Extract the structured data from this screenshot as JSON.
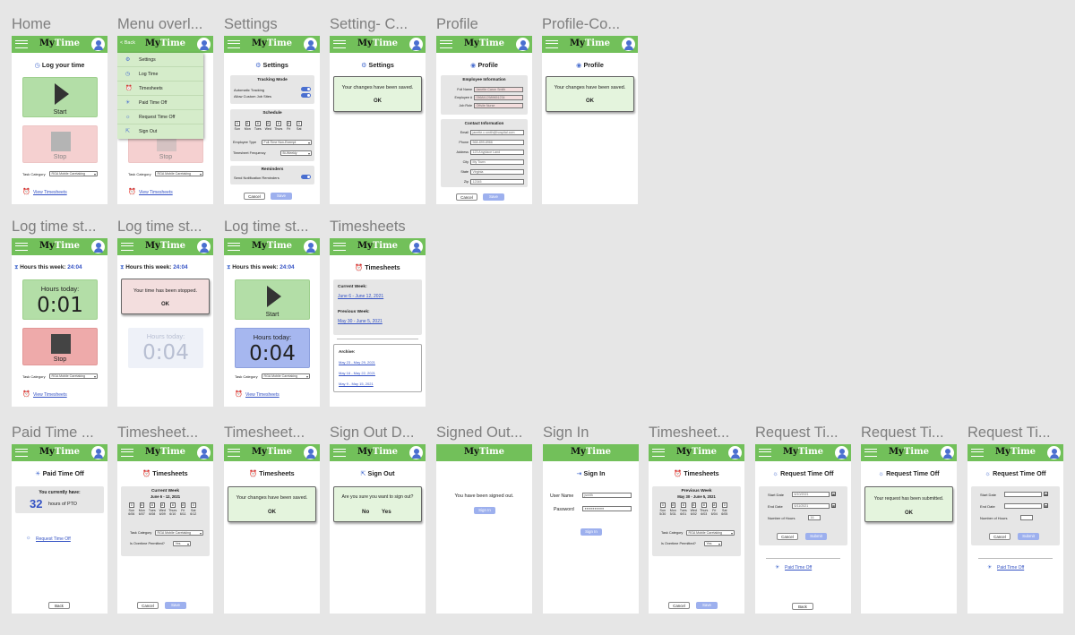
{
  "app": {
    "logo_my": "My",
    "logo_time": "Time",
    "back": "< Back"
  },
  "frames": {
    "home": "Home",
    "menu": "Menu overl...",
    "settings": "Settings",
    "settings_c": "Setting- C...",
    "profile": "Profile",
    "profile_c": "Profile-Co...",
    "lts1": "Log time st...",
    "lts2": "Log time st...",
    "lts3": "Log time st...",
    "timesheets": "Timesheets",
    "pto": "Paid Time ...",
    "ts1": "Timesheet...",
    "ts2": "Timesheet...",
    "signout": "Sign Out D...",
    "signedout": "Signed Out...",
    "signin": "Sign In",
    "ts3": "Timesheet...",
    "rto1": "Request Ti...",
    "rto2": "Request Ti...",
    "rto3": "Request Ti..."
  },
  "home": {
    "title": "Log your time",
    "start": "Start",
    "stop": "Stop",
    "task_label": "Task Category",
    "task_value": "RGA Mobile Caretaking",
    "view_timesheets": "View Timesheets"
  },
  "menu": {
    "items": [
      "Settings",
      "Log Time",
      "Timesheets",
      "Paid Time Off",
      "Request Time Off",
      "Sign Out"
    ]
  },
  "settings": {
    "title": "Settings",
    "tracking_mode": "Tracking Mode",
    "auto_tracking": "Automatic Tracking",
    "custom_sites": "Allow Custom Job Sites",
    "schedule": "Schedule",
    "days": [
      "Sun",
      "Mon",
      "Tues",
      "Wed",
      "Thurs",
      "Fri",
      "Sat"
    ],
    "day_values": [
      "0",
      "8",
      "8",
      "8",
      "8",
      "8",
      "0"
    ],
    "emp_type_label": "Employee Type",
    "emp_type_value": "Full-Time Non-Exempt",
    "freq_label": "Timesheet Frequency",
    "freq_value": "Bi-Weekly",
    "reminders": "Reminders",
    "send_reminders": "Send Notification Reminders",
    "cancel": "Cancel",
    "save": "Save"
  },
  "saved": {
    "message": "Your changes have been saved.",
    "ok": "OK"
  },
  "profile": {
    "title": "Profile",
    "emp_info": "Employee Information",
    "full_name_label": "Full Name",
    "full_name": "Janette Caron Smith",
    "emp_num_label": "Employee #",
    "emp_num": "0568412589651234",
    "job_label": "Job Role",
    "job": "Offsite Nurse",
    "contact_info": "Contact Information",
    "email_label": "Email",
    "email": "janette.c.smith@hospital.com",
    "phone_label": "Phone",
    "phone": "568-899-8966",
    "address_label": "Address",
    "address": "123 Anyplace Land",
    "city_label": "City",
    "city": "My Town",
    "state_label": "State",
    "state": "Virginia",
    "zip_label": "Zip",
    "zip": "12345"
  },
  "log": {
    "hours_week_label": "Hours this week:",
    "hours_week_value": "24:04",
    "hours_today_label": "Hours today:",
    "today1": "0:01",
    "today2": "0:04",
    "stopped_msg": "Your time has been stopped."
  },
  "timesheets": {
    "title": "Timesheets",
    "current_week": "Current Week:",
    "current_range": "June 6 - June 12, 2021",
    "previous_week": "Previous Week:",
    "previous_range": "May 30 - June 5, 2021",
    "archive": "Archive:",
    "archive_items": [
      "May 23 - May 29, 2021",
      "May 16 - May 22, 2021",
      "May 9 - May 15, 2021"
    ]
  },
  "pto": {
    "title": "Paid Time Off",
    "you_have": "You currently have:",
    "hours": "32",
    "hours_suffix": "hours of PTO",
    "request_link": "Request Time Off",
    "back": "Back"
  },
  "ts_edit": {
    "current_header": "Current Week",
    "current_range": "June 6 - 12, 2021",
    "previous_header": "Previous Week",
    "previous_range": "May 30 - June 5, 2021",
    "dates_current": [
      "6/06",
      "6/07",
      "6/08",
      "6/09",
      "6/10",
      "6/11",
      "6/12"
    ],
    "dates_previous": [
      "5/30",
      "5/31",
      "6/01",
      "6/02",
      "6/03",
      "6/04",
      "6/05"
    ],
    "task_label": "Task Category",
    "task_value": "RGA Mobile Caretaking",
    "overtime_label": "Is Overtime Permitted?",
    "overtime_value": "Yes",
    "cancel": "Cancel",
    "save": "Save"
  },
  "signout": {
    "title": "Sign Out",
    "question": "Are you sure you want to sign out?",
    "no": "No",
    "yes": "Yes",
    "signed_out": "You have been signed out.",
    "signin_btn": "Sign In"
  },
  "signin": {
    "title": "Sign In",
    "user_label": "User Name",
    "user_value": "jsmith",
    "pw_label": "Password",
    "pw_value": "●●●●●●●●●●",
    "btn": "Sign In"
  },
  "rto": {
    "title": "Request Time Off",
    "start_label": "Start Date",
    "start_value": "6/10/2021",
    "end_label": "End Date",
    "end_value": "6/11/2021",
    "hours_label": "Number of Hours",
    "hours_value": "16",
    "cancel": "Cancel",
    "submit": "Submit",
    "pto_link": "Paid Time Off",
    "back": "Back",
    "submitted": "Your request has been submitted.",
    "ok": "OK"
  }
}
